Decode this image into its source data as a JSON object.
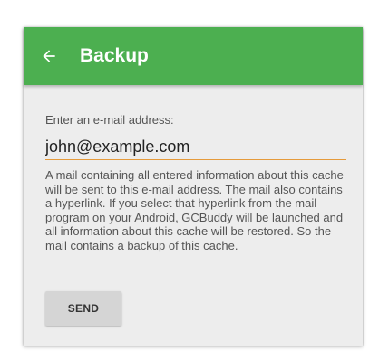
{
  "app_bar": {
    "title": "Backup",
    "back_icon": "arrow-left-icon",
    "color": "#4caf50"
  },
  "form": {
    "prompt": "Enter an e-mail address:",
    "email_value": "john@example.com",
    "underline_color": "#e59a3b",
    "description": "A mail containing all entered information about this cache will be sent to this e-mail address. The mail also contains a hyperlink. If you select that hyperlink from the mail program on your Android, GCBuddy will be launched and all information about this cache will be restored. So the mail contains a backup of this cache.",
    "send_label": "SEND"
  }
}
